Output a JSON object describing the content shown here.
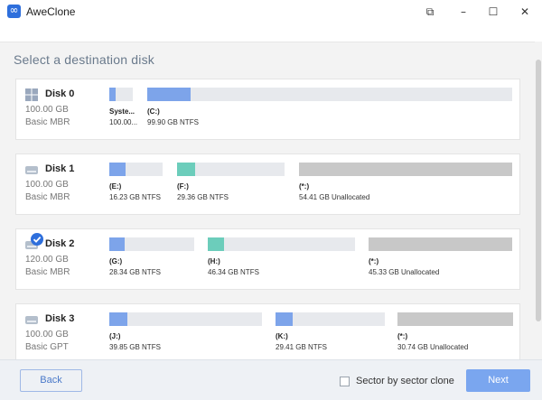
{
  "titlebar": {
    "title": "AweClone",
    "restore_glyph": "⧉",
    "minimize_glyph": "–",
    "maximize_glyph": "☐",
    "close_glyph": "✕"
  },
  "heading": "Select a destination disk",
  "disks": [
    {
      "name": "Disk 0",
      "size": "100.00 GB",
      "type": "Basic MBR",
      "selected": false,
      "partitions": [
        {
          "name": "Syste...",
          "detail": "100.00...",
          "fill_fraction": 0.25,
          "color": "#7da4ea"
        },
        {
          "name": "(C:)",
          "detail": "99.90 GB NTFS",
          "fill_fraction": 0.12,
          "color": "#7da4ea"
        }
      ]
    },
    {
      "name": "Disk 1",
      "size": "100.00 GB",
      "type": "Basic MBR",
      "selected": false,
      "partitions": [
        {
          "name": "(E:)",
          "detail": "16.23 GB NTFS",
          "fill_fraction": 0.3,
          "color": "#7da4ea"
        },
        {
          "name": "(F:)",
          "detail": "29.36 GB NTFS",
          "fill_fraction": 0.17,
          "color": "#6ccdbb"
        },
        {
          "name": "(*:)",
          "detail": "54.41 GB Unallocated",
          "fill_fraction": 1.0,
          "color": "#c8c8c8"
        }
      ]
    },
    {
      "name": "Disk 2",
      "size": "120.00 GB",
      "type": "Basic MBR",
      "selected": true,
      "partitions": [
        {
          "name": "(G:)",
          "detail": "28.34 GB NTFS",
          "fill_fraction": 0.18,
          "color": "#7da4ea"
        },
        {
          "name": "(H:)",
          "detail": "46.34 GB NTFS",
          "fill_fraction": 0.11,
          "color": "#6ccdbb"
        },
        {
          "name": "(*:)",
          "detail": "45.33 GB Unallocated",
          "fill_fraction": 1.0,
          "color": "#c8c8c8"
        }
      ]
    },
    {
      "name": "Disk 3",
      "size": "100.00 GB",
      "type": "Basic GPT",
      "selected": false,
      "partitions": [
        {
          "name": "(J:)",
          "detail": "39.85 GB NTFS",
          "fill_fraction": 0.12,
          "color": "#7da4ea"
        },
        {
          "name": "(K:)",
          "detail": "29.41 GB NTFS",
          "fill_fraction": 0.16,
          "color": "#7da4ea"
        },
        {
          "name": "(*:)",
          "detail": "30.74 GB Unallocated",
          "fill_fraction": 1.0,
          "color": "#c8c8c8"
        }
      ]
    }
  ],
  "footer": {
    "back_label": "Back",
    "sector_clone_label": "Sector by sector clone",
    "sector_clone_checked": false,
    "next_label": "Next"
  }
}
